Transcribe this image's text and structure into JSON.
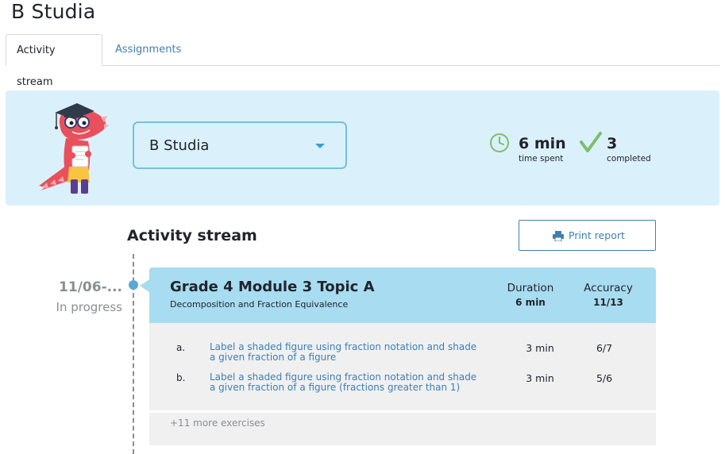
{
  "page": {
    "title": "B Studia"
  },
  "tabs": [
    {
      "label": "Activity stream",
      "active": true
    },
    {
      "label": "Assignments",
      "active": false
    }
  ],
  "banner": {
    "student_select": {
      "selected": "B Studia"
    },
    "stats": {
      "time": {
        "value": "6 min",
        "caption": "time spent",
        "icon": "clock-icon"
      },
      "completed": {
        "value": "3",
        "caption": "completed",
        "icon": "checkmark-icon"
      }
    },
    "mascot": "dinosaur-graduate-mascot"
  },
  "stream": {
    "title": "Activity stream",
    "print_label": "Print report",
    "entry": {
      "date": "11/06-...",
      "status": "In progress",
      "title": "Grade 4 Module 3 Topic A",
      "subtitle": "Decomposition and Fraction Equivalence",
      "duration_label": "Duration",
      "duration_value": "6 min",
      "accuracy_label": "Accuracy",
      "accuracy_value": "11/13",
      "exercises": [
        {
          "letter": "a.",
          "title": "Label a shaded figure using fraction notation and shade a given fraction of a figure",
          "duration": "3 min",
          "accuracy": "6/7"
        },
        {
          "letter": "b.",
          "title": "Label a shaded figure using fraction notation and shade a given fraction of a figure (fractions greater than 1)",
          "duration": "3 min",
          "accuracy": "5/6"
        }
      ],
      "more_label": "+11 more exercises"
    }
  },
  "colors": {
    "banner_bg": "#daf1fc",
    "card_header": "#a8dcf0",
    "link": "#3f7fb0",
    "accent_green": "#7cbf6b",
    "muted": "#8a8e93"
  }
}
